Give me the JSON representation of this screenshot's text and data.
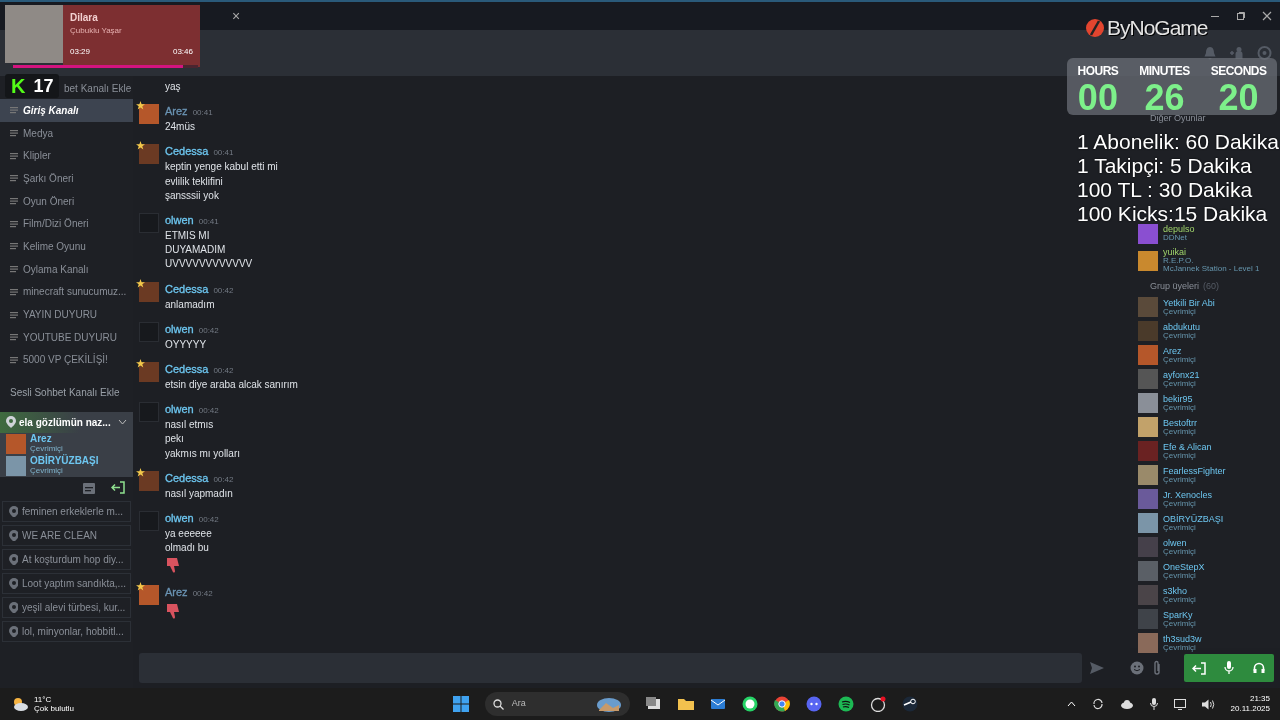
{
  "tab_close": "×",
  "music_widget": {
    "title": "Dilara",
    "artist": "Çubuklu Yaşar",
    "elapsed": "03:29",
    "duration": "03:46",
    "level": 0.92
  },
  "viewer_badge": {
    "logo": "K",
    "count": "17"
  },
  "brand_logo": {
    "text": "ByNoGame"
  },
  "timer": {
    "units": [
      {
        "label": "HOURS",
        "value": "00"
      },
      {
        "label": "MINUTES",
        "value": "26"
      },
      {
        "label": "SECONDS",
        "value": "20"
      }
    ]
  },
  "overlay_lines": [
    "1 Abonelik: 60 Dakika",
    "1 Takipçi: 5 Dakika",
    "100 TL : 30 Dakika",
    "100 Kicks:15 Dakika"
  ],
  "sidebar": {
    "add_text_channel": "bet Kanalı Ekle",
    "text_channels": [
      {
        "name": "Giriş Kanalı",
        "selected": true
      },
      {
        "name": "Medya",
        "selected": false
      },
      {
        "name": "Klipler",
        "selected": false
      },
      {
        "name": "Şarkı Öneri",
        "selected": false
      },
      {
        "name": "Oyun Öneri",
        "selected": false
      },
      {
        "name": "Film/Dizi Öneri",
        "selected": false
      },
      {
        "name": "Kelime Oyunu",
        "selected": false
      },
      {
        "name": "Oylama Kanalı",
        "selected": false
      },
      {
        "name": "minecraft sunucumuz...",
        "selected": false
      },
      {
        "name": "YAYIN DUYURU",
        "selected": false
      },
      {
        "name": "YOUTUBE DUYURU",
        "selected": false
      },
      {
        "name": "5000 VP ÇEKİLİŞİ!",
        "selected": false
      }
    ],
    "add_voice_channel": "Sesli Sohbet Kanalı Ekle",
    "active_voice": {
      "name": "ela gözlümün naz...",
      "expanded": true,
      "members": [
        {
          "name": "Arez",
          "status": "Çevrimiçi"
        },
        {
          "name": "OBİRYÜZBAŞI",
          "status": "Çevrimiçi"
        }
      ]
    },
    "voice_channels": [
      "feminen erkeklerle m...",
      "WE ARE CLEAN",
      "At koşturdum hop diy...",
      "Loot yaptım sandıkta,...",
      "yeşil alevi türbesi, kur...",
      "lol, minyonlar, hobbitl..."
    ]
  },
  "chat": {
    "messages": [
      {
        "kind": "continuation",
        "lines": [
          "yaş"
        ]
      },
      {
        "kind": "group",
        "author": "Arez",
        "color": "#6a93b3",
        "starred": true,
        "time": "00:41",
        "lines": [
          "24müs"
        ]
      },
      {
        "kind": "group",
        "author": "Cedessa",
        "color": "#6dc6f0",
        "starred": true,
        "time": "00:41",
        "lines": [
          "keptin yenge kabul etti mi",
          "evlilik teklifini",
          "şansssii yok"
        ]
      },
      {
        "kind": "group",
        "author": "olwen",
        "color": "#6dc6f0",
        "starred": false,
        "time": "00:41",
        "lines": [
          "ETMIS MI",
          "DUYAMADIM",
          "UVVVVVVVVVVVV"
        ]
      },
      {
        "kind": "group",
        "author": "Cedessa",
        "color": "#6dc6f0",
        "starred": true,
        "time": "00:42",
        "lines": [
          "anlamadım"
        ]
      },
      {
        "kind": "group",
        "author": "olwen",
        "color": "#6dc6f0",
        "starred": false,
        "time": "00:42",
        "lines": [
          "OYYYYY"
        ]
      },
      {
        "kind": "group",
        "author": "Cedessa",
        "color": "#6dc6f0",
        "starred": true,
        "time": "00:42",
        "lines": [
          "etsin diye araba alcak sanırım"
        ]
      },
      {
        "kind": "group",
        "author": "olwen",
        "color": "#6dc6f0",
        "starred": false,
        "time": "00:42",
        "lines": [
          "nasıl etmıs",
          "pekı",
          "yakmıs mı yolları"
        ]
      },
      {
        "kind": "group",
        "author": "Cedessa",
        "color": "#6dc6f0",
        "starred": true,
        "time": "00:42",
        "lines": [
          "nasıl yapmadın"
        ]
      },
      {
        "kind": "group",
        "author": "olwen",
        "color": "#6dc6f0",
        "starred": false,
        "time": "00:42",
        "lines": [
          "ya eeeeee",
          "olmadı bu"
        ],
        "thumbs_down": true
      },
      {
        "kind": "group",
        "author": "Arez",
        "color": "#6a93b3",
        "starred": true,
        "time": "00:42",
        "thumbs_down": true
      }
    ]
  },
  "right_panel": {
    "games_heading": "Diğer Oyunlar",
    "playing": [
      {
        "name": "depulso",
        "lines": [
          "DDNet"
        ]
      },
      {
        "name": "yuikai",
        "lines": [
          "R.E.P.O.",
          "McJannek Station - Level 1"
        ]
      }
    ],
    "members_heading": "Grup üyeleri",
    "members_count": "(60)",
    "members": [
      {
        "name": "Yetkili Bir Abi",
        "status": "Çevrimiçi"
      },
      {
        "name": "abdukutu",
        "status": "Çevrimiçi"
      },
      {
        "name": "Arez",
        "status": "Çevrimiçi"
      },
      {
        "name": "ayfonx21",
        "status": "Çevrimiçi"
      },
      {
        "name": "bekir95",
        "status": "Çevrimiçi"
      },
      {
        "name": "Bestoftrr",
        "status": "Çevrimiçi"
      },
      {
        "name": "Efe & Alican",
        "status": "Çevrimiçi"
      },
      {
        "name": "FearlessFighter",
        "status": "Çevrimiçi"
      },
      {
        "name": "Jr. Xenocles",
        "status": "Çevrimiçi"
      },
      {
        "name": "OBİRYÜZBAŞI",
        "status": "Çevrimiçi"
      },
      {
        "name": "olwen",
        "status": "Çevrimiçi"
      },
      {
        "name": "OneStepX",
        "status": "Çevrimiçi"
      },
      {
        "name": "s3kho",
        "status": "Çevrimiçi"
      },
      {
        "name": "SparKy",
        "status": "Çevrimiçi"
      },
      {
        "name": "th3sud3w",
        "status": "Çevrimiçi"
      }
    ]
  },
  "taskbar": {
    "temperature": "11°C",
    "weather": "Çok bulutlu",
    "search_placeholder": "Ara",
    "time": "21:35",
    "date": "20.11.2025"
  }
}
